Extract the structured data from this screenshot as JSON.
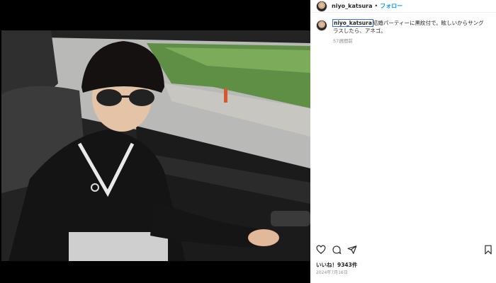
{
  "post": {
    "username": "niyo_katsura",
    "separator": "•",
    "follow_label": "フォロー",
    "caption_user": "niyo_katsura",
    "caption_text": "結婚パーティーに黒紋付で。眩しいからサングラスしたら、アネゴ。",
    "time_ago": "57週間前",
    "likes": "いいね！9343件",
    "date": "2024年7月16日"
  },
  "icons": {
    "like": "heart-icon",
    "comment": "comment-icon",
    "share": "share-icon",
    "save": "bookmark-icon"
  },
  "colors": {
    "link": "#0095f6",
    "text": "#262626",
    "secondary": "#8e8e8e"
  }
}
